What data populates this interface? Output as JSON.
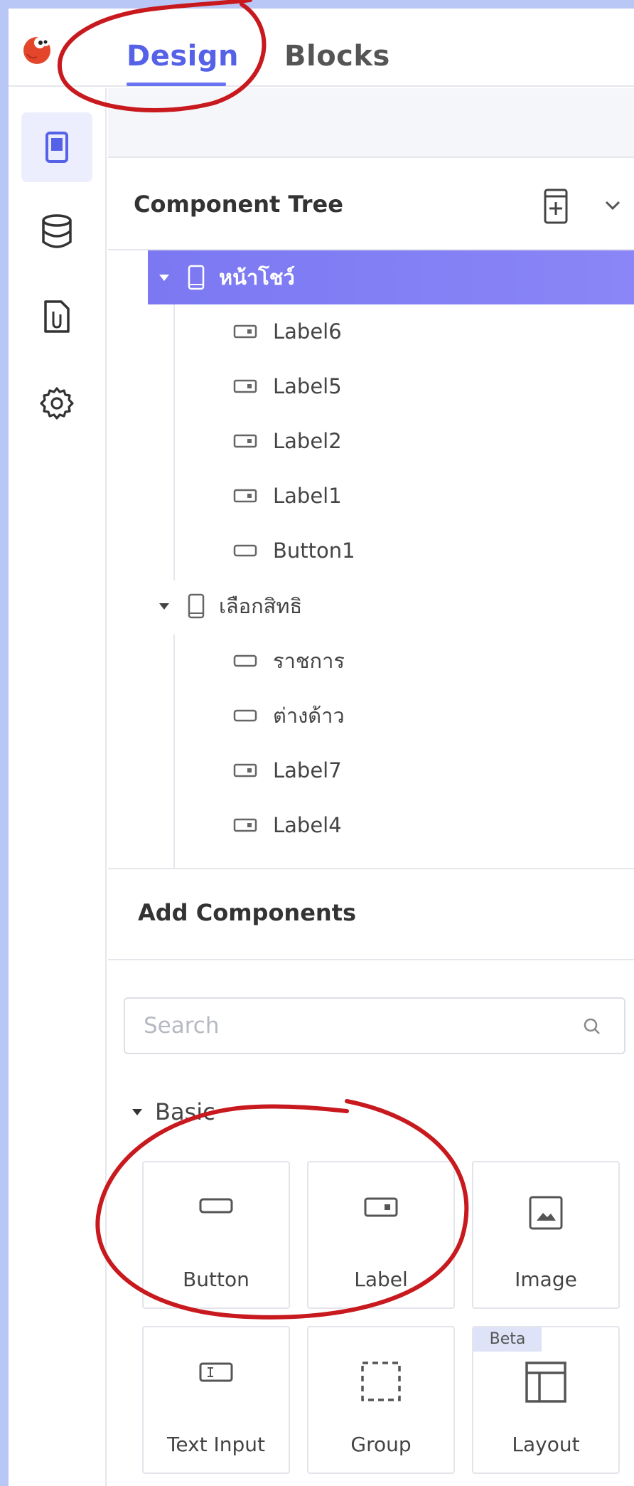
{
  "header": {
    "tabs": [
      {
        "label": "Design",
        "active": true
      },
      {
        "label": "Blocks",
        "active": false
      }
    ]
  },
  "rail": {
    "items": [
      {
        "icon": "screen-icon",
        "active": true
      },
      {
        "icon": "database-icon",
        "active": false
      },
      {
        "icon": "media-file-icon",
        "active": false
      },
      {
        "icon": "gear-icon",
        "active": false
      }
    ]
  },
  "component_tree": {
    "title": "Component Tree",
    "nodes": [
      {
        "label": "หน้าโชว์",
        "type": "screen",
        "level": 0,
        "expanded": true,
        "selected": true
      },
      {
        "label": "Label6",
        "type": "label",
        "level": 1
      },
      {
        "label": "Label5",
        "type": "label",
        "level": 1
      },
      {
        "label": "Label2",
        "type": "label",
        "level": 1
      },
      {
        "label": "Label1",
        "type": "label",
        "level": 1
      },
      {
        "label": "Button1",
        "type": "button",
        "level": 1
      },
      {
        "label": "เลือกสิทธิ",
        "type": "screen",
        "level": 0,
        "expanded": true,
        "selected": false
      },
      {
        "label": "ราชการ",
        "type": "button",
        "level": 1
      },
      {
        "label": "ต่างด้าว",
        "type": "button",
        "level": 1
      },
      {
        "label": "Label7",
        "type": "label",
        "level": 1
      },
      {
        "label": "Label4",
        "type": "label",
        "level": 1
      }
    ]
  },
  "add_components": {
    "title": "Add Components",
    "search": {
      "placeholder": "Search",
      "value": ""
    },
    "group": {
      "label": "Basic",
      "expanded": true
    },
    "items": [
      {
        "label": "Button",
        "icon": "button-icon"
      },
      {
        "label": "Label",
        "icon": "label-icon"
      },
      {
        "label": "Image",
        "icon": "image-icon"
      },
      {
        "label": "Text Input",
        "icon": "text-input-icon"
      },
      {
        "label": "Group",
        "icon": "group-icon"
      },
      {
        "label": "Layout",
        "icon": "layout-icon",
        "badge": "Beta"
      }
    ]
  },
  "colors": {
    "accent": "#5562e8",
    "selected_row": "#7b78f2",
    "annotation": "#c8191e",
    "outer_border": "#b9c7f7"
  }
}
